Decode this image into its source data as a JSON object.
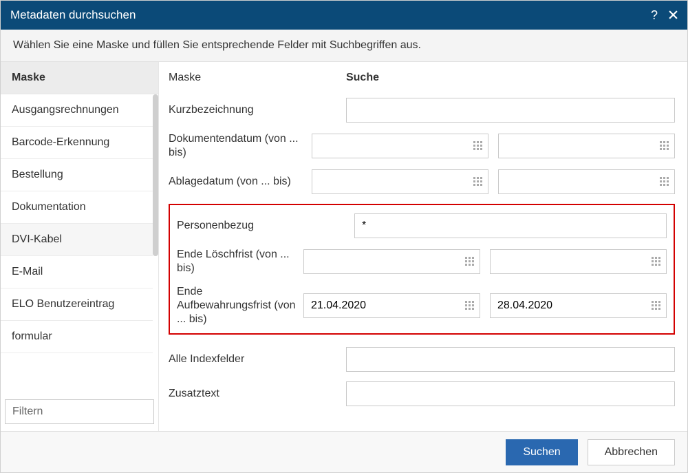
{
  "title": "Metadaten durchsuchen",
  "subtitle": "Wählen Sie eine Maske und füllen Sie entsprechende Felder mit Suchbegriffen aus.",
  "sidebar": {
    "header": "Maske",
    "filter_placeholder": "Filtern",
    "items": [
      {
        "label": "Ausgangsrechnungen"
      },
      {
        "label": "Barcode-Erkennung"
      },
      {
        "label": "Bestellung"
      },
      {
        "label": "Dokumentation"
      },
      {
        "label": "DVI-Kabel",
        "selected": true
      },
      {
        "label": "E-Mail"
      },
      {
        "label": "ELO Benutzereintrag"
      },
      {
        "label": "formular"
      }
    ]
  },
  "main": {
    "mask_header": "Maske",
    "search_header": "Suche",
    "rows": {
      "kurzbezeichnung": "Kurzbezeichnung",
      "dokumentendatum": "Dokumentendatum (von ... bis)",
      "ablagedatum": "Ablagedatum (von ... bis)",
      "personenbezug": "Personenbezug",
      "ende_loeschfrist": "Ende Löschfrist (von ... bis)",
      "ende_aufbewahrung": "Ende Aufbewahrungsfrist (von ... bis)",
      "alle_indexfelder": "Alle Indexfelder",
      "zusatztext": "Zusatztext"
    },
    "values": {
      "personenbezug": "*",
      "ende_aufbewahrung_von": "21.04.2020",
      "ende_aufbewahrung_bis": "28.04.2020"
    }
  },
  "footer": {
    "search": "Suchen",
    "cancel": "Abbrechen"
  }
}
